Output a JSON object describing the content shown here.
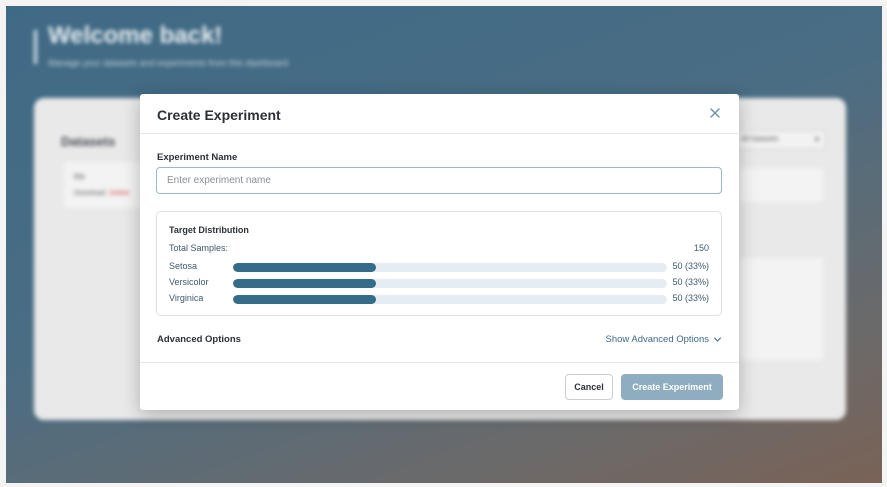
{
  "background": {
    "heading": "Welcome back!",
    "subheading": "Manage your datasets and experiments from this dashboard",
    "card_title": "Datasets",
    "row_title": "Iris",
    "row_download": "Download",
    "row_delete": "Delete",
    "filter_select": "All Datasets"
  },
  "modal": {
    "title": "Create Experiment",
    "close_icon": "close-icon",
    "name_label": "Experiment Name",
    "name_placeholder": "Enter experiment name",
    "name_value": "",
    "distribution": {
      "title": "Target Distribution",
      "total_label": "Total Samples:",
      "total_value": "150",
      "classes": [
        {
          "name": "Setosa",
          "label": "50 (33%)",
          "fraction": 0.33
        },
        {
          "name": "Versicolor",
          "label": "50 (33%)",
          "fraction": 0.33
        },
        {
          "name": "Virginica",
          "label": "50 (33%)",
          "fraction": 0.33
        }
      ]
    },
    "advanced_label": "Advanced Options",
    "advanced_toggle": "Show Advanced Options",
    "cancel_label": "Cancel",
    "create_label": "Create Experiment"
  },
  "colors": {
    "accent": "#356c8a",
    "primary_button_disabled": "#8fadc0",
    "bar_track": "#e6edf2"
  }
}
